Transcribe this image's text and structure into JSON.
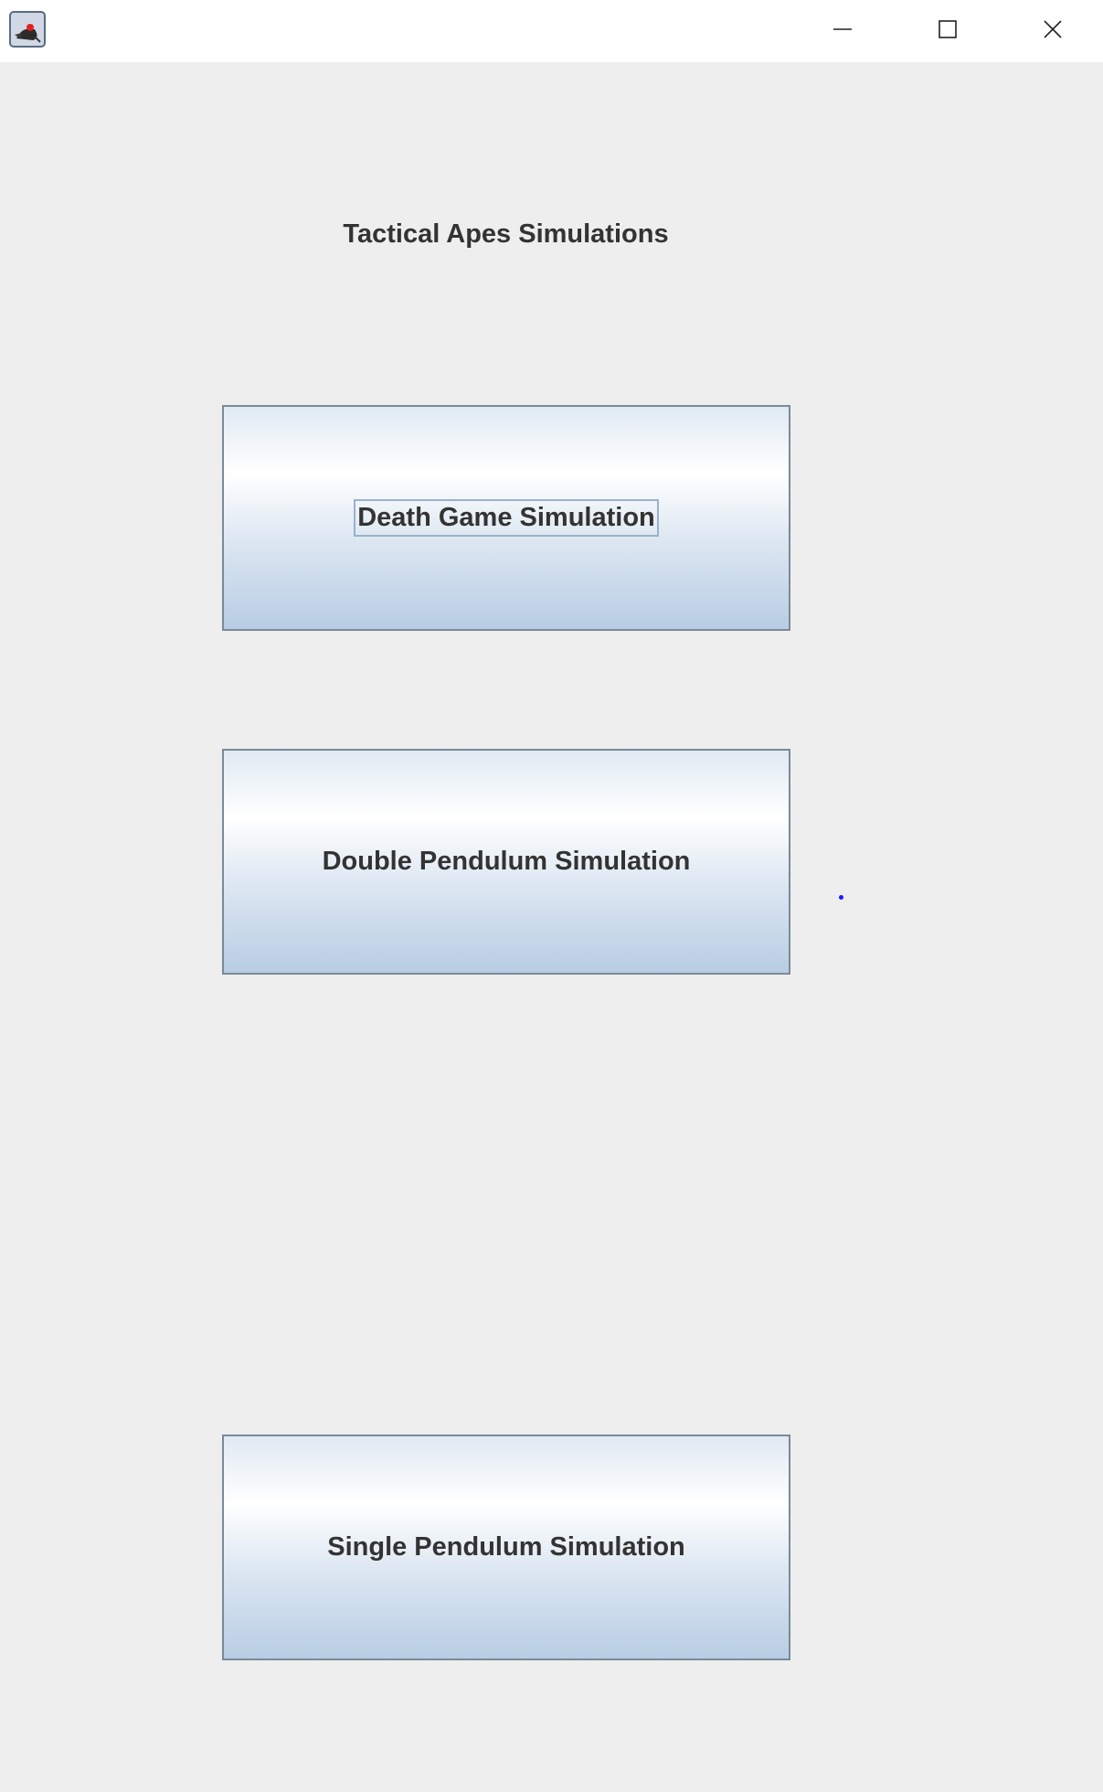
{
  "window": {
    "icons": {
      "app": "java-duke-icon",
      "minimize": "minimize-icon",
      "maximize": "maximize-icon",
      "close": "close-icon"
    }
  },
  "main": {
    "heading": "Tactical Apes Simulations",
    "buttons": [
      {
        "label": "Death Game Simulation",
        "focused": true
      },
      {
        "label": "Double Pendulum Simulation",
        "focused": false
      },
      {
        "label": "Single Pendulum Simulation",
        "focused": false
      }
    ]
  },
  "colors": {
    "background": "#eeeeee",
    "titlebar": "#ffffff",
    "text": "#333333",
    "button_border": "#7a8a99",
    "focus_border": "#99b2cc",
    "dot": "#1a1aff"
  }
}
